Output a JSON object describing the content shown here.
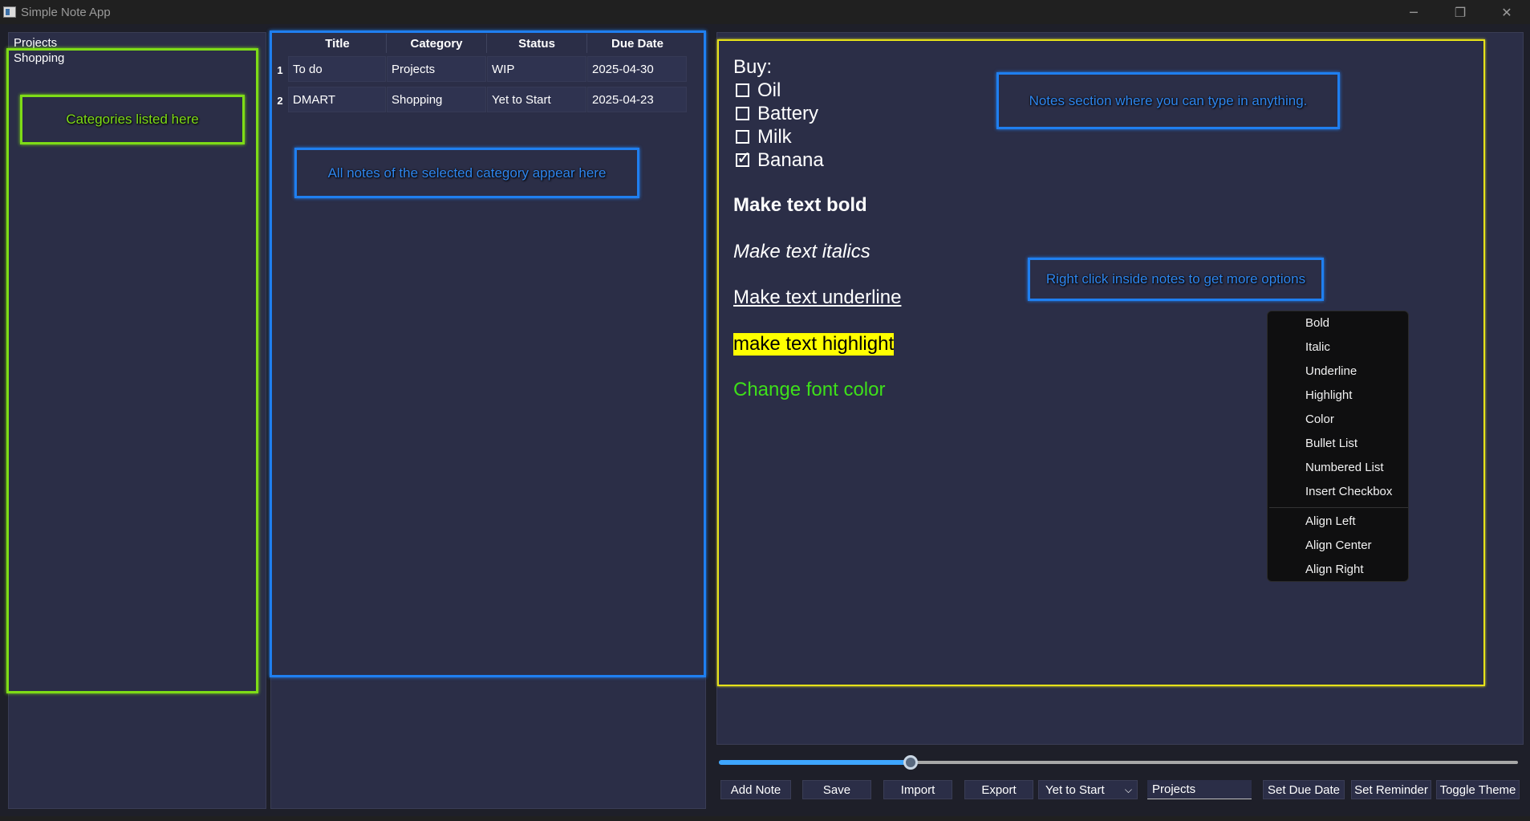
{
  "window": {
    "title": "Simple Note App",
    "controls": {
      "minimize": "─",
      "restore": "❐",
      "close": "✕"
    }
  },
  "categories": [
    "Projects",
    "Shopping"
  ],
  "notes_table": {
    "headers": [
      "Title",
      "Category",
      "Status",
      "Due Date"
    ],
    "rows": [
      {
        "num": "1",
        "title": "To do",
        "category": "Projects",
        "status": "WIP",
        "due": "2025-04-30"
      },
      {
        "num": "2",
        "title": "DMART",
        "category": "Shopping",
        "status": "Yet to Start",
        "due": "2025-04-23"
      }
    ]
  },
  "editor": {
    "buy_label": "Buy:",
    "checklist": [
      {
        "label": "Oil",
        "checked": false
      },
      {
        "label": "Battery",
        "checked": false
      },
      {
        "label": "Milk",
        "checked": false
      },
      {
        "label": "Banana",
        "checked": true
      }
    ],
    "bold_text": "Make text bold",
    "italic_text": "Make text italics",
    "underline_text": "Make text underline",
    "highlight_text": "make text highlight",
    "color_text": "Change font color"
  },
  "annotations": {
    "categories": "Categories listed here",
    "notes_list": "All notes of the selected category appear here",
    "notes_section": "Notes section where you can type in anything.",
    "right_click": "Right click inside notes to get more options"
  },
  "context_menu": {
    "group1": [
      "Bold",
      "Italic",
      "Underline",
      "Highlight",
      "Color",
      "Bullet List",
      "Numbered List",
      "Insert Checkbox"
    ],
    "group2": [
      "Align Left",
      "Align Center",
      "Align Right"
    ]
  },
  "slider": {
    "value_fraction": 0.24
  },
  "toolbar": {
    "add_note": "Add Note",
    "save": "Save",
    "import": "Import",
    "export": "Export",
    "status_value": "Yet to Start",
    "category_value": "Projects",
    "set_due_date": "Set Due Date",
    "set_reminder": "Set Reminder",
    "toggle_theme": "Toggle Theme"
  },
  "colors": {
    "annotation_green": "#7edc17",
    "annotation_blue": "#1f7ff0",
    "annotation_yellow": "#e6e21a",
    "highlight": "#ffff00",
    "font_color_green": "#3ee01a",
    "slider_accent": "#3ea6ff"
  }
}
